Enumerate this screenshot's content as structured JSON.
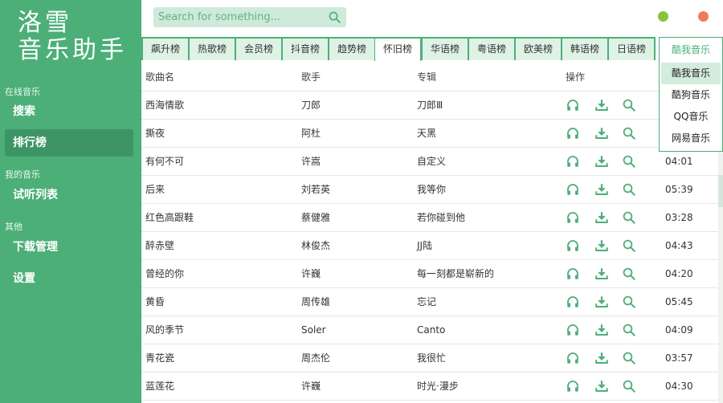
{
  "app": {
    "logo_line1": "洛雪",
    "logo_line2": "音乐助手"
  },
  "colors": {
    "primary": "#4caf78",
    "primary_dark": "#3d9465",
    "tab_bg": "#dff2e6",
    "minimize_dot": "#85c43f",
    "close_dot": "#ef7a5a"
  },
  "sidebar": {
    "sections": [
      {
        "title": "在线音乐",
        "items": [
          {
            "label": "搜索",
            "active": false
          },
          {
            "label": "排行榜",
            "active": true
          }
        ]
      },
      {
        "title": "我的音乐",
        "items": [
          {
            "label": "试听列表",
            "active": false
          }
        ]
      },
      {
        "title": "其他",
        "items": [
          {
            "label": "下载管理",
            "active": false
          },
          {
            "label": "设置",
            "active": false
          }
        ]
      }
    ]
  },
  "search": {
    "placeholder": "Search for something...",
    "icon": "search-icon"
  },
  "tabs": [
    "飙升榜",
    "热歌榜",
    "会员榜",
    "抖音榜",
    "趋势榜",
    "怀旧榜",
    "华语榜",
    "粤语榜",
    "欧美榜",
    "韩语榜",
    "日语榜"
  ],
  "active_tab": 5,
  "table": {
    "columns": {
      "song": "歌曲名",
      "singer": "歌手",
      "album": "专辑",
      "ops": "操作"
    },
    "op_icons": [
      "headphones-icon",
      "download-icon",
      "search-icon"
    ],
    "rows": [
      {
        "song": "西海情歌",
        "singer": "刀郎",
        "album": "刀郎Ⅲ",
        "duration": ""
      },
      {
        "song": "撕夜",
        "singer": "阿杜",
        "album": "天黑",
        "duration": ""
      },
      {
        "song": "有何不可",
        "singer": "许嵩",
        "album": "自定义",
        "duration": "04:01"
      },
      {
        "song": "后来",
        "singer": "刘若英",
        "album": "我等你",
        "duration": "05:39"
      },
      {
        "song": "红色高跟鞋",
        "singer": "蔡健雅",
        "album": "若你碰到他",
        "duration": "03:28"
      },
      {
        "song": "醉赤壁",
        "singer": "林俊杰",
        "album": "JJ陆",
        "duration": "04:43"
      },
      {
        "song": "曾经的你",
        "singer": "许巍",
        "album": "每一刻都是崭新的",
        "duration": "04:20"
      },
      {
        "song": "黄昏",
        "singer": "周传雄",
        "album": "忘记",
        "duration": "05:45"
      },
      {
        "song": "风的季节",
        "singer": "Soler",
        "album": "Canto",
        "duration": "04:09"
      },
      {
        "song": "青花瓷",
        "singer": "周杰伦",
        "album": "我很忙",
        "duration": "03:57"
      },
      {
        "song": "蓝莲花",
        "singer": "许巍",
        "album": "时光·漫步",
        "duration": "04:30"
      }
    ]
  },
  "source_dropdown": {
    "selected": "酷我音乐",
    "options": [
      "酷我音乐",
      "酷狗音乐",
      "QQ音乐",
      "网易音乐"
    ],
    "highlighted": 0
  }
}
